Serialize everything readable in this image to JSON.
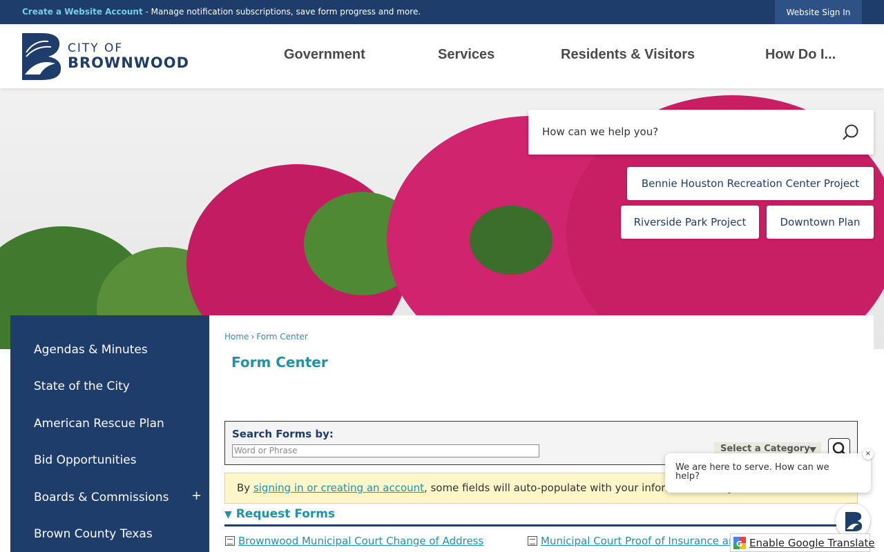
{
  "topbar": {
    "create_account": "Create a Website Account",
    "message": " - Manage notification subscriptions, save form progress and more.",
    "sign_in": "Website Sign In"
  },
  "logo": {
    "city_of": "CITY OF",
    "name": "BROWNWOOD"
  },
  "nav": [
    "Government",
    "Services",
    "Residents & Visitors",
    "How Do I..."
  ],
  "hero": {
    "search_placeholder": "How can we help you?",
    "quick_links": [
      "Bennie Houston Recreation Center Project",
      "Riverside Park Project",
      "Downtown Plan"
    ]
  },
  "sidebar": {
    "items": [
      "Agendas & Minutes",
      "State of the City",
      "American Rescue Plan",
      "Bid Opportunities",
      "Boards & Commissions",
      "Brown County Texas"
    ],
    "expand_symbol": "+"
  },
  "breadcrumb": {
    "home": "Home",
    "separator": "›",
    "current": "Form Center"
  },
  "page_title": "Form Center",
  "search": {
    "label": "Search Forms by:",
    "placeholder": "Word or Phrase",
    "category": "Select a Category"
  },
  "notice": {
    "prefix": "By ",
    "link": "signing in or creating an account",
    "suffix": ", some fields will auto-populate with your information and your submitted forms will be saved."
  },
  "section": {
    "arrow": "▼",
    "title": "Request Forms"
  },
  "forms": [
    "Brownwood Municipal Court Change of Address",
    "Municipal Court Proof of Insurance and Registration"
  ],
  "chat": {
    "message": "We are here to serve. How can we help?",
    "close": "×"
  },
  "translate": {
    "label": "Enable Google Translate"
  },
  "colors": {
    "navy": "#1e3d6b",
    "teal": "#1f93a8",
    "accent_pink": "#d81b60"
  }
}
